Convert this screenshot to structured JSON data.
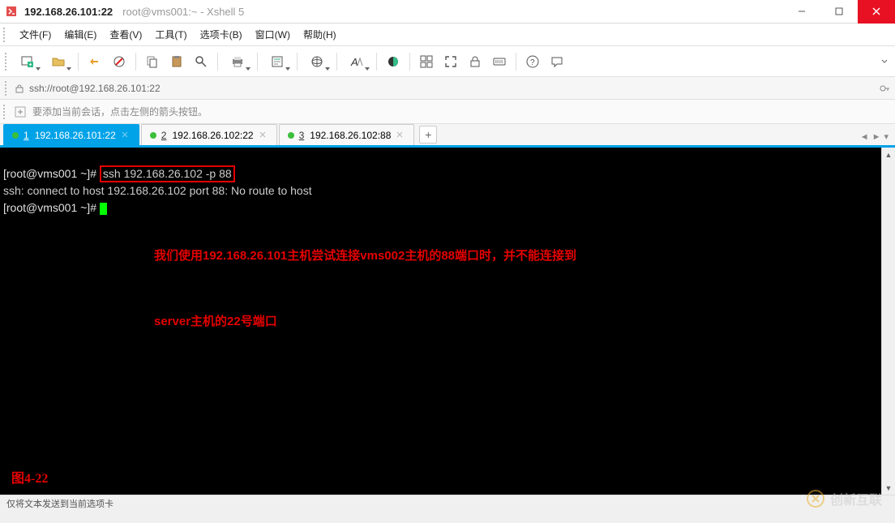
{
  "titlebar": {
    "host": "192.168.26.101:22",
    "subtitle": "root@vms001:~ - Xshell 5"
  },
  "menubar": {
    "items": [
      {
        "key": "file",
        "label": "文件(F)"
      },
      {
        "key": "edit",
        "label": "编辑(E)"
      },
      {
        "key": "view",
        "label": "查看(V)"
      },
      {
        "key": "tools",
        "label": "工具(T)"
      },
      {
        "key": "tabs",
        "label": "选项卡(B)"
      },
      {
        "key": "window",
        "label": "窗口(W)"
      },
      {
        "key": "help",
        "label": "帮助(H)"
      }
    ]
  },
  "toolbar": {
    "icons": [
      "new-session-icon",
      "open-icon",
      "_sep",
      "reconnect-icon",
      "disconnect-icon",
      "_sep",
      "copy-icon",
      "paste-icon",
      "find-icon",
      "_sep",
      "print-icon",
      "_sep",
      "properties-icon",
      "_sep",
      "browser-icon",
      "_sep",
      "font-icon",
      "_sep",
      "color-scheme-icon",
      "_sep",
      "tile-icon",
      "fullscreen-icon",
      "lock-icon",
      "keyboard-icon",
      "_sep",
      "help-icon",
      "feedback-icon"
    ],
    "dropdown_icons": [
      "new-session-icon",
      "open-icon",
      "print-icon",
      "properties-icon",
      "browser-icon",
      "font-icon"
    ]
  },
  "addressbar": {
    "url": "ssh://root@192.168.26.101:22"
  },
  "hintbar": {
    "text": "要添加当前会话，点击左侧的箭头按钮。"
  },
  "tabs": {
    "items": [
      {
        "num": "1",
        "label": "192.168.26.101:22",
        "active": true
      },
      {
        "num": "2",
        "label": "192.168.26.102:22",
        "active": false
      },
      {
        "num": "3",
        "label": "192.168.26.102:88",
        "active": false
      }
    ],
    "add_label": "+"
  },
  "terminal": {
    "line1_prompt": "[root@vms001 ~]# ",
    "line1_cmd": "ssh 192.168.26.102 -p 88",
    "line2": "ssh: connect to host 192.168.26.102 port 88: No route to host",
    "line3_prompt": "[root@vms001 ~]# ",
    "annotation_line1": "我们使用192.168.26.101主机尝试连接vms002主机的88端口时，并不能连接到",
    "annotation_line2": "server主机的22号端口",
    "figure_label": "图4-22"
  },
  "statusbar": {
    "text": "仅将文本发送到当前选项卡"
  },
  "watermark": {
    "text": "创新互联"
  },
  "colors": {
    "accent": "#00a2e8",
    "close_btn": "#e81123",
    "annotation": "#e40000"
  }
}
